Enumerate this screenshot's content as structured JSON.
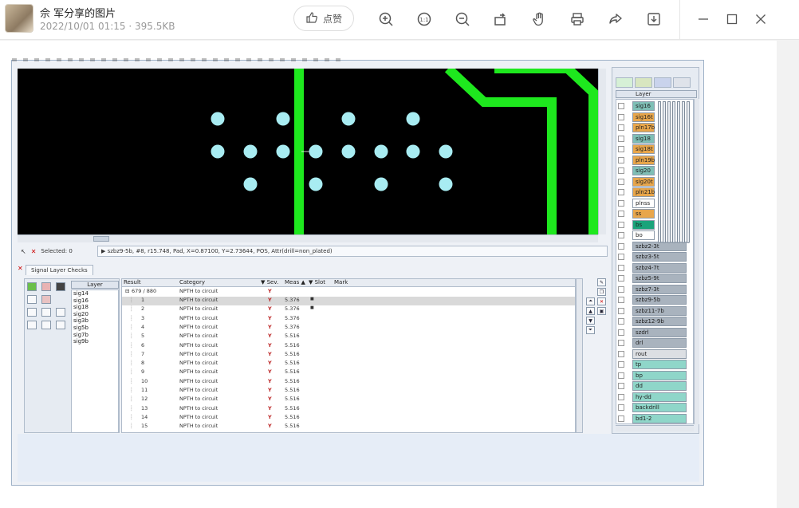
{
  "header": {
    "title": "佘  军分享的图片",
    "meta": "2022/10/01 01:15 · 395.5KB",
    "like_label": "点赞"
  },
  "toolbar": {
    "icons": [
      "zoom-in-icon",
      "actual-size-icon",
      "zoom-out-icon",
      "rotate-icon",
      "hand-icon",
      "print-icon",
      "share-icon",
      "download-icon"
    ]
  },
  "status": {
    "selected": "Selected: 0",
    "info": "▶ szbz9-5b, #8, r15.748, Pad, X=0.87100, Y=2.73644, POS, Attr(drill=non_plated)"
  },
  "bottom": {
    "tab": "Signal Layer Checks",
    "layer_header": "Layer",
    "layers": [
      "sig14",
      "sig16",
      "sig18",
      "sig20",
      "sig3b",
      "sig5b",
      "sig7b",
      "sig9b"
    ],
    "grid_headers": [
      "Result",
      "Category",
      "▼ Sev.",
      "Meas ▲",
      "▼ Slot",
      "Mark"
    ],
    "summary_row": {
      "result": "679 / 880",
      "category": "NPTH to circuit"
    },
    "rows": [
      {
        "n": "1",
        "cat": "NPTH to circuit",
        "meas": "5.376",
        "slot": "■"
      },
      {
        "n": "2",
        "cat": "NPTH to circuit",
        "meas": "5.376",
        "slot": "■"
      },
      {
        "n": "3",
        "cat": "NPTH to circuit",
        "meas": "5.376",
        "slot": ""
      },
      {
        "n": "4",
        "cat": "NPTH to circuit",
        "meas": "5.376",
        "slot": ""
      },
      {
        "n": "5",
        "cat": "NPTH to circuit",
        "meas": "5.516",
        "slot": ""
      },
      {
        "n": "6",
        "cat": "NPTH to circuit",
        "meas": "5.516",
        "slot": ""
      },
      {
        "n": "7",
        "cat": "NPTH to circuit",
        "meas": "5.516",
        "slot": ""
      },
      {
        "n": "8",
        "cat": "NPTH to circuit",
        "meas": "5.516",
        "slot": ""
      },
      {
        "n": "9",
        "cat": "NPTH to circuit",
        "meas": "5.516",
        "slot": ""
      },
      {
        "n": "10",
        "cat": "NPTH to circuit",
        "meas": "5.516",
        "slot": ""
      },
      {
        "n": "11",
        "cat": "NPTH to circuit",
        "meas": "5.516",
        "slot": ""
      },
      {
        "n": "12",
        "cat": "NPTH to circuit",
        "meas": "5.516",
        "slot": ""
      },
      {
        "n": "13",
        "cat": "NPTH to circuit",
        "meas": "5.516",
        "slot": ""
      },
      {
        "n": "14",
        "cat": "NPTH to circuit",
        "meas": "5.516",
        "slot": ""
      },
      {
        "n": "15",
        "cat": "NPTH to circuit",
        "meas": "5.516",
        "slot": ""
      }
    ]
  },
  "right_panel": {
    "header": "Layer",
    "layers": [
      {
        "name": "sig16",
        "color": "#7fbfb6"
      },
      {
        "name": "sig16t",
        "color": "#e8a64b"
      },
      {
        "name": "pln17b",
        "color": "#e8a64b"
      },
      {
        "name": "sig18",
        "color": "#7fbfb6"
      },
      {
        "name": "sig18t",
        "color": "#e8a64b"
      },
      {
        "name": "pln19b",
        "color": "#e8a64b"
      },
      {
        "name": "sig20",
        "color": "#7fbfb6"
      },
      {
        "name": "sig20t",
        "color": "#e8a64b"
      },
      {
        "name": "pln21b",
        "color": "#e8a64b"
      },
      {
        "name": "plnss",
        "color": "#ffffff"
      },
      {
        "name": "ss",
        "color": "#e8a64b"
      },
      {
        "name": "bs",
        "color": "#1aa37a"
      },
      {
        "name": "bo",
        "color": "#ffffff"
      },
      {
        "name": "szbz2-3t",
        "color": "#a9b3be"
      },
      {
        "name": "szbz3-5t",
        "color": "#a9b3be"
      },
      {
        "name": "szbz4-7t",
        "color": "#a9b3be"
      },
      {
        "name": "szbz5-9t",
        "color": "#a9b3be"
      },
      {
        "name": "szbz7-3t",
        "color": "#a9b3be"
      },
      {
        "name": "szbz9-5b",
        "color": "#a9b3be"
      },
      {
        "name": "szbz11-7b",
        "color": "#a9b3be"
      },
      {
        "name": "szbz12-9b",
        "color": "#a9b3be"
      },
      {
        "name": "szdrl",
        "color": "#a9b3be"
      },
      {
        "name": "drl",
        "color": "#a9b3be"
      },
      {
        "name": "rout",
        "color": "#dcdfe3"
      },
      {
        "name": "tp",
        "color": "#8fd6c9"
      },
      {
        "name": "bp",
        "color": "#8fd6c9"
      },
      {
        "name": "dd",
        "color": "#8fd6c9"
      },
      {
        "name": "hy-dd",
        "color": "#8fd6c9"
      },
      {
        "name": "backdrill",
        "color": "#8fd6c9"
      },
      {
        "name": "bd1-2",
        "color": "#8fd6c9"
      }
    ]
  },
  "colors": {
    "pad": "#a8ecf2",
    "trace": "#1ee81e",
    "board_bg": "#000000"
  }
}
